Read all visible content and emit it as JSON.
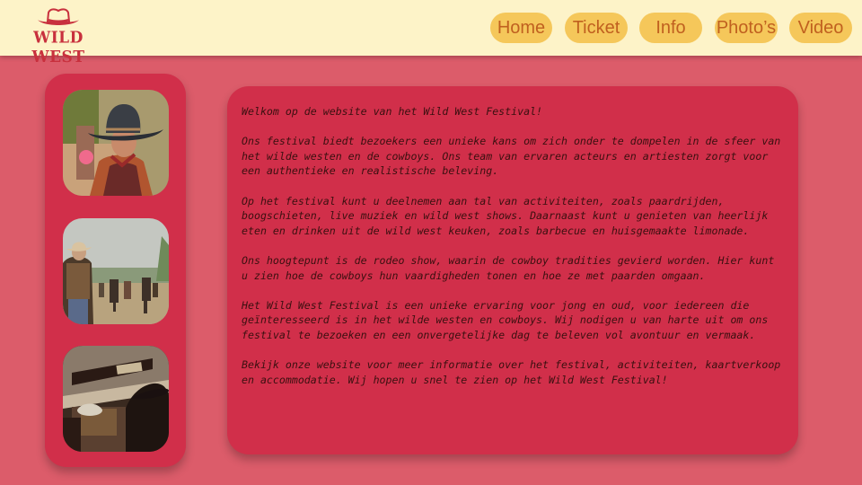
{
  "brand": {
    "logo_text": "WILD WEST",
    "logo_icon": "cowboy-hat-icon",
    "colors": {
      "header_bg": "#fdf3c8",
      "page_bg": "#dc5c6a",
      "panel_bg": "#d12f4a",
      "nav_button_bg": "#f5c75a",
      "nav_text": "#c0601f",
      "logo_red": "#c8303d"
    }
  },
  "nav": {
    "home": "Home",
    "ticket": "Ticket",
    "info": "Info",
    "photos": "Photo’s",
    "video": "Video"
  },
  "photos": [
    {
      "subject": "cowboy-with-hat-photo"
    },
    {
      "subject": "cowboys-at-festival-photo"
    },
    {
      "subject": "saloon-scene-photo"
    }
  ],
  "content": {
    "paragraphs": [
      "Welkom op de website van het Wild West Festival!",
      "Ons festival biedt bezoekers een unieke kans om zich onder te dompelen in de sfeer van het wilde westen en de cowboys. Ons team van ervaren acteurs en artiesten zorgt voor een authentieke en realistische beleving.",
      "Op het festival kunt u deelnemen aan tal van activiteiten, zoals paardrijden, boogschieten, live muziek en wild west shows. Daarnaast kunt u genieten van heerlijk eten en drinken uit de wild west keuken, zoals barbecue en huisgemaakte limonade.",
      "Ons hoogtepunt is de rodeo show, waarin de cowboy tradities gevierd worden. Hier kunt u zien hoe de cowboys hun vaardigheden tonen en hoe ze met paarden omgaan.",
      "Het Wild West Festival is een unieke ervaring voor jong en oud, voor iedereen die geïnteresseerd is in het wilde westen en cowboys. Wij nodigen u van harte uit om ons festival te bezoeken en een onvergetelijke dag te beleven vol avontuur en vermaak.",
      "Bekijk onze website voor meer informatie over het festival, activiteiten, kaartverkoop en accommodatie. Wij hopen u snel te zien op het Wild West Festival!"
    ]
  }
}
